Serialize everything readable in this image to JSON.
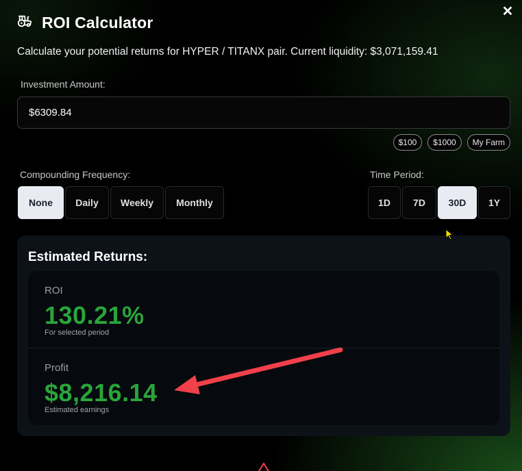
{
  "modal": {
    "title": "ROI Calculator",
    "close_label": "✕",
    "description": "Calculate your potential returns for HYPER / TITANX pair. Current liquidity: $3,071,159.41"
  },
  "investment": {
    "label": "Investment Amount:",
    "value": "$6309.84",
    "presets": [
      "$100",
      "$1000",
      "My Farm"
    ]
  },
  "compounding": {
    "label": "Compounding Frequency:",
    "options": [
      "None",
      "Daily",
      "Weekly",
      "Monthly"
    ],
    "selected": "None"
  },
  "time_period": {
    "label": "Time Period:",
    "options": [
      "1D",
      "7D",
      "30D",
      "1Y"
    ],
    "selected": "30D"
  },
  "returns": {
    "title": "Estimated Returns:",
    "roi_label": "ROI",
    "roi_value": "130.21%",
    "roi_sub": "For selected period",
    "profit_label": "Profit",
    "profit_value": "$8,216.14",
    "profit_sub": "Estimated earnings"
  },
  "colors": {
    "accent_green": "#2aa53a",
    "annotation_arrow": "#f0404a",
    "active_button": "#e8ebf2"
  },
  "icons": {
    "header": "tractor-icon",
    "close": "close-icon",
    "cursor": "mouse-pointer-icon",
    "annotation": "red-arrow-annotation",
    "warning": "warning-triangle-icon"
  }
}
